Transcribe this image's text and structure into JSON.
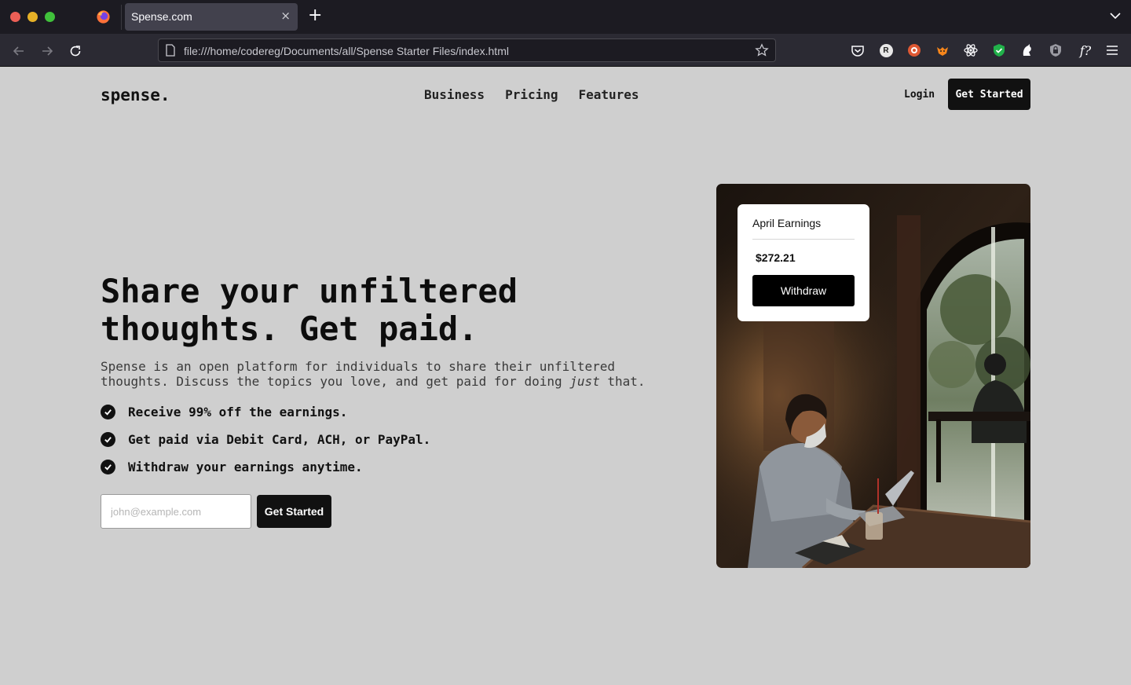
{
  "browser": {
    "tab_title": "Spense.com",
    "tab_close": "×",
    "new_tab": "+",
    "url": "file:///home/codereg/Documents/all/Spense Starter Files/index.html",
    "extensions": [
      "pocket-icon",
      "r-extension-icon",
      "duckduckgo-icon",
      "fox-extension-icon",
      "react-devtools-icon",
      "shield-check-icon",
      "ghost-icon",
      "lock-icon",
      "font-finder-icon"
    ],
    "ext_letter": "R",
    "font_ext_label": "f?"
  },
  "nav": {
    "logo": "spense.",
    "links": [
      "Business",
      "Pricing",
      "Features"
    ],
    "login": "Login",
    "cta": "Get Started"
  },
  "hero": {
    "headline_line1": "Share your unfiltered",
    "headline_line2": "thoughts. Get paid.",
    "sub_line1": "Spense is an open platform for individuals to share their unfiltered",
    "sub_line2_pre": "thoughts. Discuss the topics you love, and get paid for doing ",
    "sub_line2_em": "just",
    "sub_line2_post": " that.",
    "features": [
      "Receive 99% off the earnings.",
      "Get paid via Debit Card, ACH, or PayPal.",
      "Withdraw your earnings anytime."
    ],
    "email_placeholder": "john@example.com",
    "cta": "Get Started"
  },
  "card": {
    "title": "April Earnings",
    "amount": "$272.21",
    "button": "Withdraw"
  },
  "colors": {
    "page_bg": "#cfcfcf",
    "button_bg": "#111111",
    "browser_bg": "#1c1b22"
  }
}
